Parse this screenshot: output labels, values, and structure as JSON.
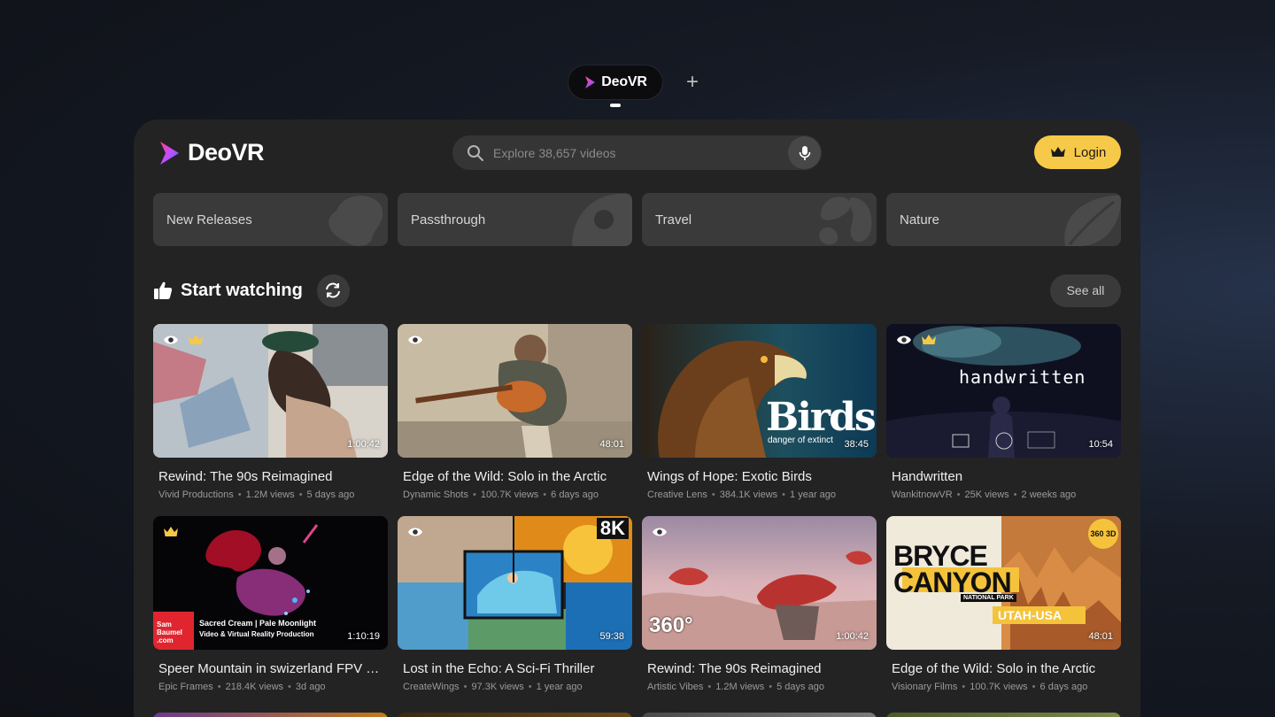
{
  "tabs": [
    {
      "label": "DeoVR",
      "active": true
    }
  ],
  "add_tab_glyph": "+",
  "brand": {
    "name": "DeoVR",
    "accent": "#f7c948"
  },
  "search": {
    "placeholder": "Explore 38,657 videos"
  },
  "login": {
    "label": "Login"
  },
  "categories": [
    {
      "label": "New Releases"
    },
    {
      "label": "Passthrough"
    },
    {
      "label": "Travel"
    },
    {
      "label": "Nature"
    }
  ],
  "section": {
    "title": "Start watching",
    "see_all": "See all"
  },
  "videos": [
    {
      "title": "Rewind: The 90s Reimagined",
      "channel": "Vivid Productions",
      "views": "1.2M views",
      "age": "5 days ago",
      "duration": "1:00:42",
      "icons": [
        "eye-icon",
        "crown-icon"
      ]
    },
    {
      "title": "Edge of the Wild: Solo in the Arctic",
      "channel": "Dynamic Shots",
      "views": "100.7K views",
      "age": "6 days ago",
      "duration": "48:01",
      "icons": [
        "eye-icon"
      ]
    },
    {
      "title": "Wings of Hope: Exotic Birds",
      "channel": "Creative Lens",
      "views": "384.1K views",
      "age": "1 year ago",
      "duration": "38:45",
      "icons": [],
      "overlay": "Birds",
      "overlay_sub": "danger of extinct"
    },
    {
      "title": "Handwritten",
      "channel": "WankitnowVR",
      "views": "25K views",
      "age": "2 weeks ago",
      "duration": "10:54",
      "icons": [
        "eye-icon",
        "crown-icon"
      ],
      "overlay": "handwritten"
    },
    {
      "title": "Speer Mountain in swizerland FPV Dro...",
      "channel": "Epic Frames",
      "views": "218.4K views",
      "age": "3d ago",
      "duration": "1:10:19",
      "icons": [
        "crown-icon"
      ],
      "overlay_brand": "Sam Baumel .com",
      "overlay_line1": "Sacred Cream | Pale Moonlight",
      "overlay_line2": "Video & Virtual Reality Production"
    },
    {
      "title": "Lost in the Echo: A Sci-Fi Thriller",
      "channel": "CreateWings",
      "views": "97.3K views",
      "age": "1 year ago",
      "duration": "59:38",
      "icons": [
        "eye-icon"
      ],
      "overlay": "8K"
    },
    {
      "title": "Rewind: The 90s Reimagined",
      "channel": "Artistic Vibes",
      "views": "1.2M views",
      "age": "5 days ago",
      "duration": "1:00:42",
      "icons": [
        "eye-icon"
      ],
      "overlay": "360°"
    },
    {
      "title": "Edge of the Wild: Solo in the Arctic",
      "channel": "Visionary Films",
      "views": "100.7K views",
      "age": "6 days ago",
      "duration": "48:01",
      "icons": [],
      "overlay": "BRYCE CANYON",
      "overlay_sub": "NATIONAL PARK",
      "overlay_loc": "UTAH-USA",
      "overlay_badge": "360 3D"
    }
  ]
}
